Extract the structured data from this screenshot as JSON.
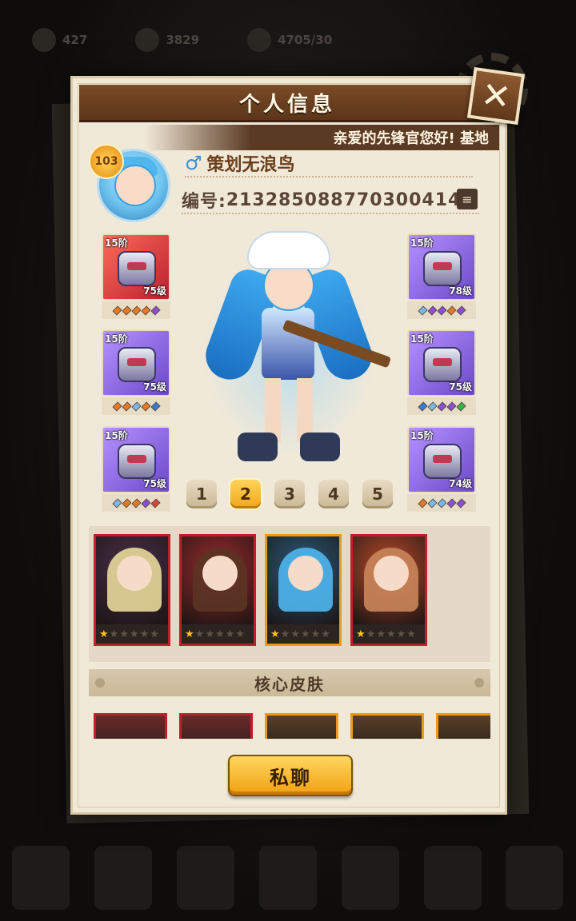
{
  "background": {
    "resources": [
      "427",
      "3829",
      "4705/30"
    ]
  },
  "modal": {
    "title": "个人信息",
    "greeting": "亲爱的先锋官您好! 基地",
    "close_label": "✕"
  },
  "player": {
    "level": "103",
    "gender_icon": "♂",
    "name": "策划无浪鸟",
    "id_label": "编号:",
    "id_value": "2132850887703004144",
    "copy_icon": "≡"
  },
  "equipment": {
    "left": [
      {
        "tier": "15阶",
        "level": "75级",
        "rarity": "red",
        "gems": [
          "#e07a2a",
          "#e07a2a",
          "#e07a2a",
          "#e07a2a",
          "#8a4fd6"
        ]
      },
      {
        "tier": "15阶",
        "level": "75级",
        "rarity": "purple",
        "gems": [
          "#e07a2a",
          "#e07a2a",
          "#7ab8e8",
          "#e07a2a",
          "#3a7ad6"
        ]
      },
      {
        "tier": "15阶",
        "level": "75级",
        "rarity": "purple",
        "gems": [
          "#7ab8e8",
          "#e07a2a",
          "#e07a2a",
          "#8a4fd6",
          "#d6453a"
        ]
      }
    ],
    "right": [
      {
        "tier": "15阶",
        "level": "78级",
        "rarity": "purple",
        "gems": [
          "#7ab8e8",
          "#8a4fd6",
          "#8a4fd6",
          "#e07a2a",
          "#8a4fd6"
        ]
      },
      {
        "tier": "15阶",
        "level": "75级",
        "rarity": "purple",
        "gems": [
          "#3a7ad6",
          "#7ab8e8",
          "#8a4fd6",
          "#8a4fd6",
          "#3ab04a"
        ]
      },
      {
        "tier": "15阶",
        "level": "74级",
        "rarity": "purple",
        "gems": [
          "#e07a2a",
          "#7ab8e8",
          "#7ab8e8",
          "#8a4fd6",
          "#8a4fd6"
        ]
      }
    ]
  },
  "pages": {
    "items": [
      "1",
      "2",
      "3",
      "4",
      "5"
    ],
    "active": "2"
  },
  "team": [
    {
      "border": "red",
      "bg": "#4a2f4a",
      "hair": "#e8d99a",
      "stars": 1
    },
    {
      "border": "red",
      "bg": "#9a2a2a",
      "hair": "#5a3424",
      "stars": 1
    },
    {
      "border": "orange",
      "bg": "#2a5a7a",
      "hair": "#4fb6ee",
      "stars": 1
    },
    {
      "border": "red",
      "bg": "#b84a2a",
      "hair": "#c9855a",
      "stars": 1
    }
  ],
  "skins": {
    "header": "核心皮肤",
    "cards": [
      "red",
      "red",
      "orange",
      "orange",
      "orange"
    ]
  },
  "chat_button": "私聊"
}
